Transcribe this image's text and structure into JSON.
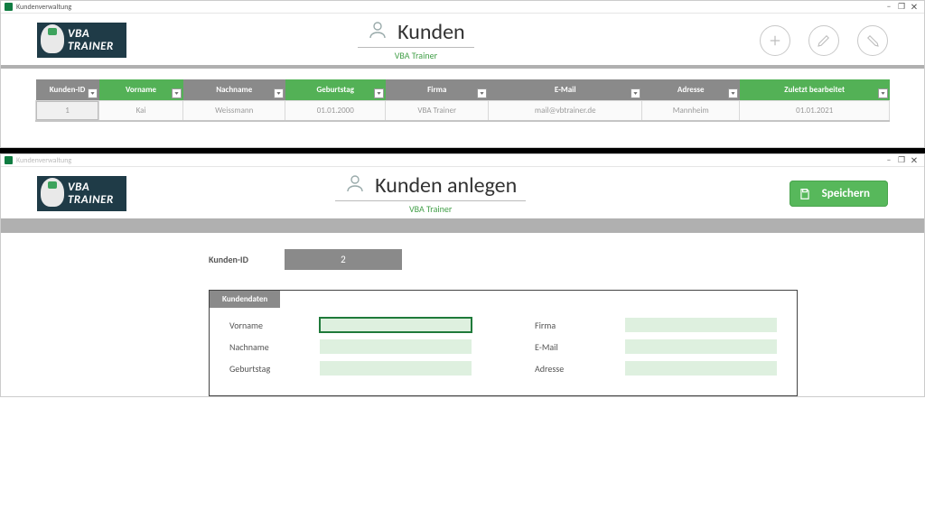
{
  "windows": {
    "controls": {
      "minimize": "−",
      "maximize": "❐",
      "close": "✕"
    }
  },
  "brand": {
    "line1": "VBA",
    "line2": "TRAINER"
  },
  "win1": {
    "titlebar": "Kundenverwaltung",
    "page_title": "Kunden",
    "page_subtitle": "VBA Trainer",
    "actions": {
      "add": "add",
      "edit": "edit",
      "delete": "delete"
    },
    "table": {
      "headers": {
        "id": "Kunden-ID",
        "vorname": "Vorname",
        "nachname": "Nachname",
        "geburtstag": "Geburtstag",
        "firma": "Firma",
        "email": "E-Mail",
        "adresse": "Adresse",
        "zuletzt": "Zuletzt bearbeitet"
      },
      "row": {
        "id": "1",
        "vorname": "Kai",
        "nachname": "Weissmann",
        "geburtstag": "01.01.2000",
        "firma": "VBA Trainer",
        "email": "mail@vbtrainer.de",
        "adresse": "Mannheim",
        "zuletzt": "01.01.2021"
      }
    }
  },
  "win2": {
    "titlebar": "Kundenverwaltung",
    "page_title": "Kunden anlegen",
    "page_subtitle": "VBA Trainer",
    "save_label": "Speichern",
    "kid_label": "Kunden-ID",
    "kid_value": "2",
    "form": {
      "tab_label": "Kundendaten",
      "left": {
        "vorname": "Vorname",
        "nachname": "Nachname",
        "geburtstag": "Geburtstag"
      },
      "right": {
        "firma": "Firma",
        "email": "E-Mail",
        "adresse": "Adresse"
      },
      "values": {
        "vorname": "",
        "nachname": "",
        "geburtstag": "",
        "firma": "",
        "email": "",
        "adresse": ""
      }
    }
  }
}
